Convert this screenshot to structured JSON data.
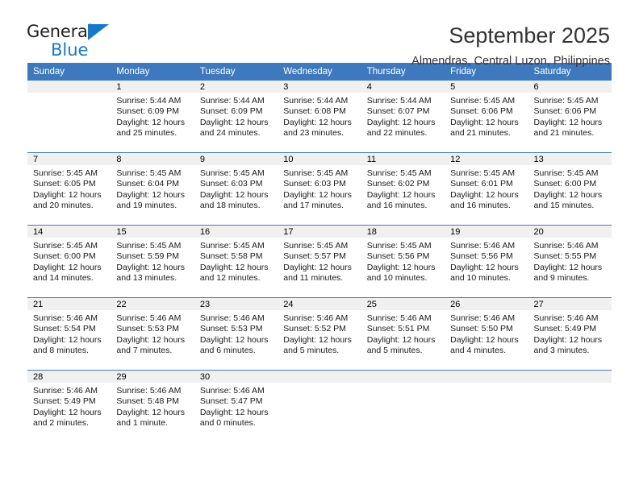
{
  "brand": {
    "name_part1": "General",
    "name_part2": "Blue",
    "triangle_color": "#1878c8"
  },
  "header": {
    "title": "September 2025",
    "subtitle": "Almendras, Central Luzon, Philippines"
  },
  "theme": {
    "header_bg": "#3e79bd",
    "header_text": "#ffffff",
    "daynum_band_bg": "#f0f0f0",
    "row_divider": "#3e79bd",
    "page_bg": "#ffffff"
  },
  "weekday_headers": [
    "Sunday",
    "Monday",
    "Tuesday",
    "Wednesday",
    "Thursday",
    "Friday",
    "Saturday"
  ],
  "labels": {
    "sunrise_prefix": "Sunrise:",
    "sunset_prefix": "Sunset:",
    "daylight_prefix": "Daylight:"
  },
  "weeks": [
    [
      {
        "day": "",
        "sunrise": "",
        "sunset": "",
        "daylight": "",
        "empty": true
      },
      {
        "day": "1",
        "sunrise": "Sunrise: 5:44 AM",
        "sunset": "Sunset: 6:09 PM",
        "daylight": "Daylight: 12 hours and 25 minutes."
      },
      {
        "day": "2",
        "sunrise": "Sunrise: 5:44 AM",
        "sunset": "Sunset: 6:09 PM",
        "daylight": "Daylight: 12 hours and 24 minutes."
      },
      {
        "day": "3",
        "sunrise": "Sunrise: 5:44 AM",
        "sunset": "Sunset: 6:08 PM",
        "daylight": "Daylight: 12 hours and 23 minutes."
      },
      {
        "day": "4",
        "sunrise": "Sunrise: 5:44 AM",
        "sunset": "Sunset: 6:07 PM",
        "daylight": "Daylight: 12 hours and 22 minutes."
      },
      {
        "day": "5",
        "sunrise": "Sunrise: 5:45 AM",
        "sunset": "Sunset: 6:06 PM",
        "daylight": "Daylight: 12 hours and 21 minutes."
      },
      {
        "day": "6",
        "sunrise": "Sunrise: 5:45 AM",
        "sunset": "Sunset: 6:06 PM",
        "daylight": "Daylight: 12 hours and 21 minutes."
      }
    ],
    [
      {
        "day": "7",
        "sunrise": "Sunrise: 5:45 AM",
        "sunset": "Sunset: 6:05 PM",
        "daylight": "Daylight: 12 hours and 20 minutes."
      },
      {
        "day": "8",
        "sunrise": "Sunrise: 5:45 AM",
        "sunset": "Sunset: 6:04 PM",
        "daylight": "Daylight: 12 hours and 19 minutes."
      },
      {
        "day": "9",
        "sunrise": "Sunrise: 5:45 AM",
        "sunset": "Sunset: 6:03 PM",
        "daylight": "Daylight: 12 hours and 18 minutes."
      },
      {
        "day": "10",
        "sunrise": "Sunrise: 5:45 AM",
        "sunset": "Sunset: 6:03 PM",
        "daylight": "Daylight: 12 hours and 17 minutes."
      },
      {
        "day": "11",
        "sunrise": "Sunrise: 5:45 AM",
        "sunset": "Sunset: 6:02 PM",
        "daylight": "Daylight: 12 hours and 16 minutes."
      },
      {
        "day": "12",
        "sunrise": "Sunrise: 5:45 AM",
        "sunset": "Sunset: 6:01 PM",
        "daylight": "Daylight: 12 hours and 16 minutes."
      },
      {
        "day": "13",
        "sunrise": "Sunrise: 5:45 AM",
        "sunset": "Sunset: 6:00 PM",
        "daylight": "Daylight: 12 hours and 15 minutes."
      }
    ],
    [
      {
        "day": "14",
        "sunrise": "Sunrise: 5:45 AM",
        "sunset": "Sunset: 6:00 PM",
        "daylight": "Daylight: 12 hours and 14 minutes."
      },
      {
        "day": "15",
        "sunrise": "Sunrise: 5:45 AM",
        "sunset": "Sunset: 5:59 PM",
        "daylight": "Daylight: 12 hours and 13 minutes."
      },
      {
        "day": "16",
        "sunrise": "Sunrise: 5:45 AM",
        "sunset": "Sunset: 5:58 PM",
        "daylight": "Daylight: 12 hours and 12 minutes."
      },
      {
        "day": "17",
        "sunrise": "Sunrise: 5:45 AM",
        "sunset": "Sunset: 5:57 PM",
        "daylight": "Daylight: 12 hours and 11 minutes."
      },
      {
        "day": "18",
        "sunrise": "Sunrise: 5:45 AM",
        "sunset": "Sunset: 5:56 PM",
        "daylight": "Daylight: 12 hours and 10 minutes."
      },
      {
        "day": "19",
        "sunrise": "Sunrise: 5:46 AM",
        "sunset": "Sunset: 5:56 PM",
        "daylight": "Daylight: 12 hours and 10 minutes."
      },
      {
        "day": "20",
        "sunrise": "Sunrise: 5:46 AM",
        "sunset": "Sunset: 5:55 PM",
        "daylight": "Daylight: 12 hours and 9 minutes."
      }
    ],
    [
      {
        "day": "21",
        "sunrise": "Sunrise: 5:46 AM",
        "sunset": "Sunset: 5:54 PM",
        "daylight": "Daylight: 12 hours and 8 minutes."
      },
      {
        "day": "22",
        "sunrise": "Sunrise: 5:46 AM",
        "sunset": "Sunset: 5:53 PM",
        "daylight": "Daylight: 12 hours and 7 minutes."
      },
      {
        "day": "23",
        "sunrise": "Sunrise: 5:46 AM",
        "sunset": "Sunset: 5:53 PM",
        "daylight": "Daylight: 12 hours and 6 minutes."
      },
      {
        "day": "24",
        "sunrise": "Sunrise: 5:46 AM",
        "sunset": "Sunset: 5:52 PM",
        "daylight": "Daylight: 12 hours and 5 minutes."
      },
      {
        "day": "25",
        "sunrise": "Sunrise: 5:46 AM",
        "sunset": "Sunset: 5:51 PM",
        "daylight": "Daylight: 12 hours and 5 minutes."
      },
      {
        "day": "26",
        "sunrise": "Sunrise: 5:46 AM",
        "sunset": "Sunset: 5:50 PM",
        "daylight": "Daylight: 12 hours and 4 minutes."
      },
      {
        "day": "27",
        "sunrise": "Sunrise: 5:46 AM",
        "sunset": "Sunset: 5:49 PM",
        "daylight": "Daylight: 12 hours and 3 minutes."
      }
    ],
    [
      {
        "day": "28",
        "sunrise": "Sunrise: 5:46 AM",
        "sunset": "Sunset: 5:49 PM",
        "daylight": "Daylight: 12 hours and 2 minutes."
      },
      {
        "day": "29",
        "sunrise": "Sunrise: 5:46 AM",
        "sunset": "Sunset: 5:48 PM",
        "daylight": "Daylight: 12 hours and 1 minute."
      },
      {
        "day": "30",
        "sunrise": "Sunrise: 5:46 AM",
        "sunset": "Sunset: 5:47 PM",
        "daylight": "Daylight: 12 hours and 0 minutes."
      },
      {
        "day": "",
        "sunrise": "",
        "sunset": "",
        "daylight": "",
        "empty": true
      },
      {
        "day": "",
        "sunrise": "",
        "sunset": "",
        "daylight": "",
        "empty": true
      },
      {
        "day": "",
        "sunrise": "",
        "sunset": "",
        "daylight": "",
        "empty": true
      },
      {
        "day": "",
        "sunrise": "",
        "sunset": "",
        "daylight": "",
        "empty": true
      }
    ]
  ]
}
